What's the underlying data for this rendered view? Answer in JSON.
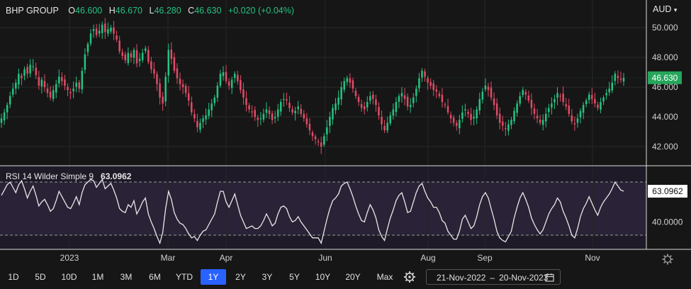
{
  "header": {
    "symbol": "BHP GROUP",
    "open_label": "O",
    "open": "46.600",
    "high_label": "H",
    "high": "46.670",
    "low_label": "L",
    "low": "46.280",
    "close_label": "C",
    "close": "46.630",
    "change": "+0.020 (+0.04%)",
    "currency": "AUD"
  },
  "last_price_badge": "46.630",
  "rsi": {
    "label": "RSI 14 Wilder Simple 9",
    "value": "63.0962",
    "badge": "63.0962",
    "level_label": "40.0000"
  },
  "toolbar": {
    "ranges": [
      "1D",
      "5D",
      "10D",
      "1M",
      "3M",
      "6M",
      "YTD",
      "1Y",
      "2Y",
      "3Y",
      "5Y",
      "10Y",
      "20Y",
      "Max"
    ],
    "active": "1Y",
    "date_from": "21-Nov-2022",
    "date_sep": "–",
    "date_to": "20-Nov-2023"
  },
  "icons": {
    "settings": "gear-icon",
    "calendar": "calendar-icon"
  },
  "colors": {
    "up": "#26c281",
    "down": "#e04c66",
    "rsi_line": "#e8e8e8",
    "active_button": "#2962ff"
  },
  "chart_data": [
    {
      "type": "candlestick",
      "title": "BHP GROUP",
      "x_tick_labels": [
        "2023",
        "Mar",
        "Apr",
        "Jun",
        "Aug",
        "Sep",
        "Nov"
      ],
      "y_tick_labels": [
        "42.000",
        "44.000",
        "46.000",
        "48.000",
        "50.000"
      ],
      "ylim": [
        41.0,
        51.5
      ],
      "grid": true,
      "last_close": 46.63,
      "closes": [
        43.9,
        44.3,
        44.8,
        45.4,
        45.9,
        46.3,
        46.9,
        46.6,
        47.2,
        46.9,
        47.5,
        47.4,
        46.8,
        46.1,
        46.5,
        46.0,
        45.6,
        45.3,
        45.8,
        46.2,
        46.7,
        46.4,
        46.1,
        45.8,
        45.6,
        45.9,
        46.3,
        45.9,
        47.1,
        48.2,
        48.9,
        49.6,
        49.9,
        49.5,
        49.8,
        50.2,
        49.7,
        49.9,
        50.0,
        49.6,
        49.2,
        48.4,
        48.1,
        47.8,
        48.3,
        48.0,
        48.5,
        47.6,
        47.9,
        48.3,
        48.6,
        47.7,
        47.2,
        46.9,
        46.2,
        45.3,
        44.9,
        46.7,
        48.5,
        47.9,
        47.1,
        46.6,
        46.2,
        46.0,
        45.6,
        45.1,
        44.3,
        43.9,
        43.3,
        43.6,
        43.9,
        44.1,
        44.5,
        44.9,
        45.3,
        46.1,
        46.9,
        47.0,
        46.4,
        46.1,
        46.5,
        46.9,
        46.4,
        45.8,
        45.3,
        44.8,
        44.5,
        44.3,
        44.0,
        43.8,
        43.9,
        44.2,
        44.5,
        44.2,
        43.8,
        44.0,
        44.5,
        45.0,
        45.2,
        45.1,
        44.6,
        44.3,
        44.4,
        44.7,
        44.2,
        43.9,
        43.5,
        43.1,
        42.7,
        42.5,
        42.3,
        42.0,
        42.7,
        43.3,
        44.0,
        44.6,
        44.9,
        45.3,
        46.0,
        46.4,
        46.6,
        46.3,
        45.9,
        45.4,
        45.0,
        44.6,
        44.5,
        45.0,
        45.4,
        45.2,
        44.8,
        44.1,
        43.5,
        43.1,
        43.6,
        44.1,
        44.5,
        45.0,
        45.4,
        45.6,
        45.2,
        44.7,
        44.8,
        45.3,
        45.9,
        46.6,
        47.1,
        46.7,
        46.3,
        46.1,
        45.8,
        45.7,
        45.4,
        45.0,
        44.8,
        44.3,
        43.9,
        43.6,
        43.4,
        43.8,
        44.3,
        44.5,
        44.2,
        43.8,
        44.0,
        44.5,
        45.2,
        45.7,
        46.1,
        45.8,
        45.3,
        44.8,
        44.1,
        43.6,
        43.4,
        43.2,
        43.5,
        43.8,
        44.4,
        44.9,
        45.4,
        45.8,
        45.5,
        45.1,
        44.6,
        44.2,
        43.9,
        43.6,
        43.8,
        44.2,
        44.6,
        44.9,
        45.2,
        45.6,
        45.4,
        45.0,
        44.7,
        44.2,
        43.7,
        43.5,
        43.9,
        44.4,
        44.8,
        45.1,
        45.5,
        45.2,
        44.9,
        44.6,
        45.0,
        45.3,
        45.6,
        45.9,
        46.3,
        46.9,
        46.6,
        46.5,
        46.63
      ]
    },
    {
      "type": "line",
      "title": "RSI 14 Wilder Simple 9",
      "y_tick_labels": [
        "40.0000"
      ],
      "ylim": [
        22,
        78
      ],
      "bands": [
        70,
        30
      ],
      "last_value": 63.0962,
      "values": [
        60,
        64,
        68,
        70,
        66,
        62,
        68,
        71,
        65,
        58,
        63,
        67,
        60,
        52,
        55,
        57,
        53,
        48,
        50,
        56,
        63,
        59,
        55,
        51,
        50,
        54,
        59,
        53,
        62,
        68,
        70,
        72,
        71,
        66,
        69,
        72,
        65,
        67,
        69,
        64,
        58,
        50,
        48,
        47,
        53,
        51,
        56,
        46,
        50,
        55,
        58,
        46,
        40,
        35,
        29,
        24,
        32,
        50,
        63,
        57,
        47,
        42,
        39,
        38,
        35,
        31,
        28,
        29,
        26,
        30,
        33,
        34,
        38,
        42,
        46,
        55,
        63,
        63,
        55,
        51,
        56,
        61,
        53,
        45,
        40,
        35,
        36,
        37,
        35,
        35,
        37,
        41,
        46,
        42,
        37,
        39,
        46,
        51,
        52,
        50,
        44,
        40,
        41,
        44,
        40,
        37,
        34,
        31,
        28,
        28,
        28,
        24,
        33,
        42,
        50,
        56,
        58,
        61,
        67,
        69,
        70,
        65,
        59,
        52,
        46,
        41,
        40,
        47,
        53,
        49,
        43,
        34,
        29,
        26,
        35,
        43,
        49,
        56,
        60,
        62,
        55,
        47,
        48,
        55,
        62,
        67,
        69,
        63,
        58,
        55,
        51,
        51,
        47,
        41,
        39,
        33,
        30,
        27,
        27,
        33,
        42,
        45,
        40,
        35,
        37,
        44,
        53,
        59,
        62,
        58,
        50,
        42,
        33,
        28,
        26,
        25,
        29,
        33,
        43,
        51,
        58,
        62,
        57,
        51,
        43,
        38,
        34,
        31,
        34,
        40,
        46,
        50,
        53,
        58,
        55,
        48,
        43,
        37,
        30,
        28,
        35,
        44,
        50,
        54,
        59,
        54,
        49,
        45,
        51,
        55,
        58,
        61,
        65,
        70,
        67,
        64,
        63.0962
      ]
    }
  ]
}
